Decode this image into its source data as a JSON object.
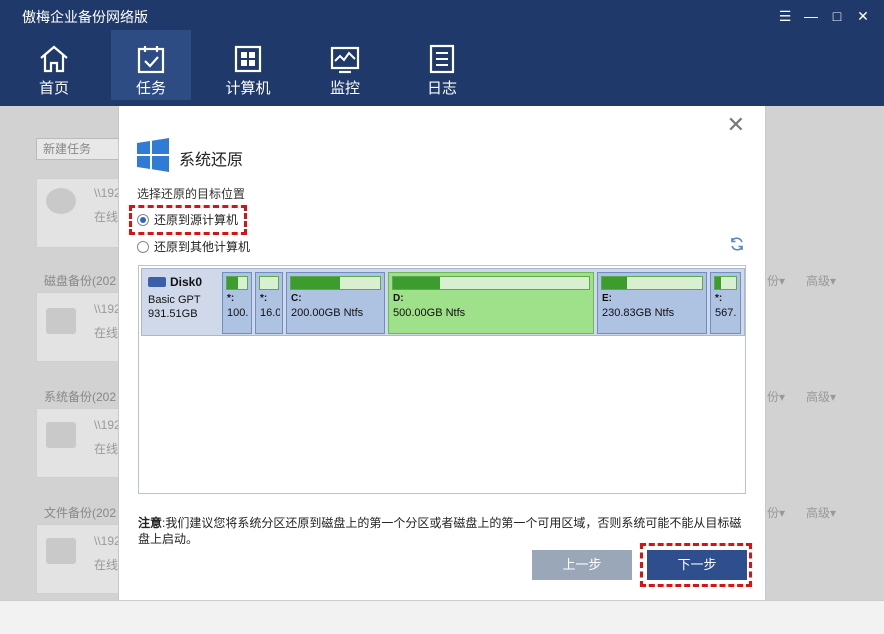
{
  "app": {
    "title": "傲梅企业备份网络版"
  },
  "window_controls": {
    "menu": "☰",
    "minimize": "—",
    "maximize": "□",
    "close": "✕"
  },
  "nav": {
    "items": [
      {
        "label": "首页",
        "icon": "home-icon"
      },
      {
        "label": "任务",
        "icon": "task-icon",
        "active": true
      },
      {
        "label": "计算机",
        "icon": "computer-icon"
      },
      {
        "label": "监控",
        "icon": "monitor-icon"
      },
      {
        "label": "日志",
        "icon": "log-icon"
      }
    ]
  },
  "background": {
    "new_task": "新建任务",
    "sections": [
      "磁盘备份(202",
      "系统备份(202",
      "文件备份(202"
    ],
    "path_prefix": "\\\\192",
    "status": "在线",
    "right_links": [
      "份▾",
      "高级▾"
    ]
  },
  "dialog": {
    "close": "✕",
    "title": "系统还原",
    "subtitle": "选择还原的目标位置",
    "options": [
      {
        "label": "还原到源计算机",
        "checked": true
      },
      {
        "label": "还原到其他计算机",
        "checked": false
      }
    ],
    "disk": {
      "name": "Disk0",
      "type": "Basic GPT",
      "size": "931.51GB",
      "partitions": [
        {
          "label": "*:",
          "size": "100.",
          "fill": 0.55
        },
        {
          "label": "*:",
          "size": "16.0",
          "fill": 0.0
        },
        {
          "label": "C:",
          "size": "200.00GB Ntfs",
          "fill": 0.55
        },
        {
          "label": "D:",
          "size": "500.00GB Ntfs",
          "fill": 0.24
        },
        {
          "label": "E:",
          "size": "230.83GB Ntfs",
          "fill": 0.25
        },
        {
          "label": "*:",
          "size": "567.",
          "fill": 0.3
        }
      ]
    },
    "note_label": "注意",
    "note_text": ":我们建议您将系统分区还原到磁盘上的第一个分区或者磁盘上的第一个可用区域，否则系统可能不能从目标磁盘上启动。",
    "prev_button": "上一步",
    "next_button": "下一步"
  }
}
